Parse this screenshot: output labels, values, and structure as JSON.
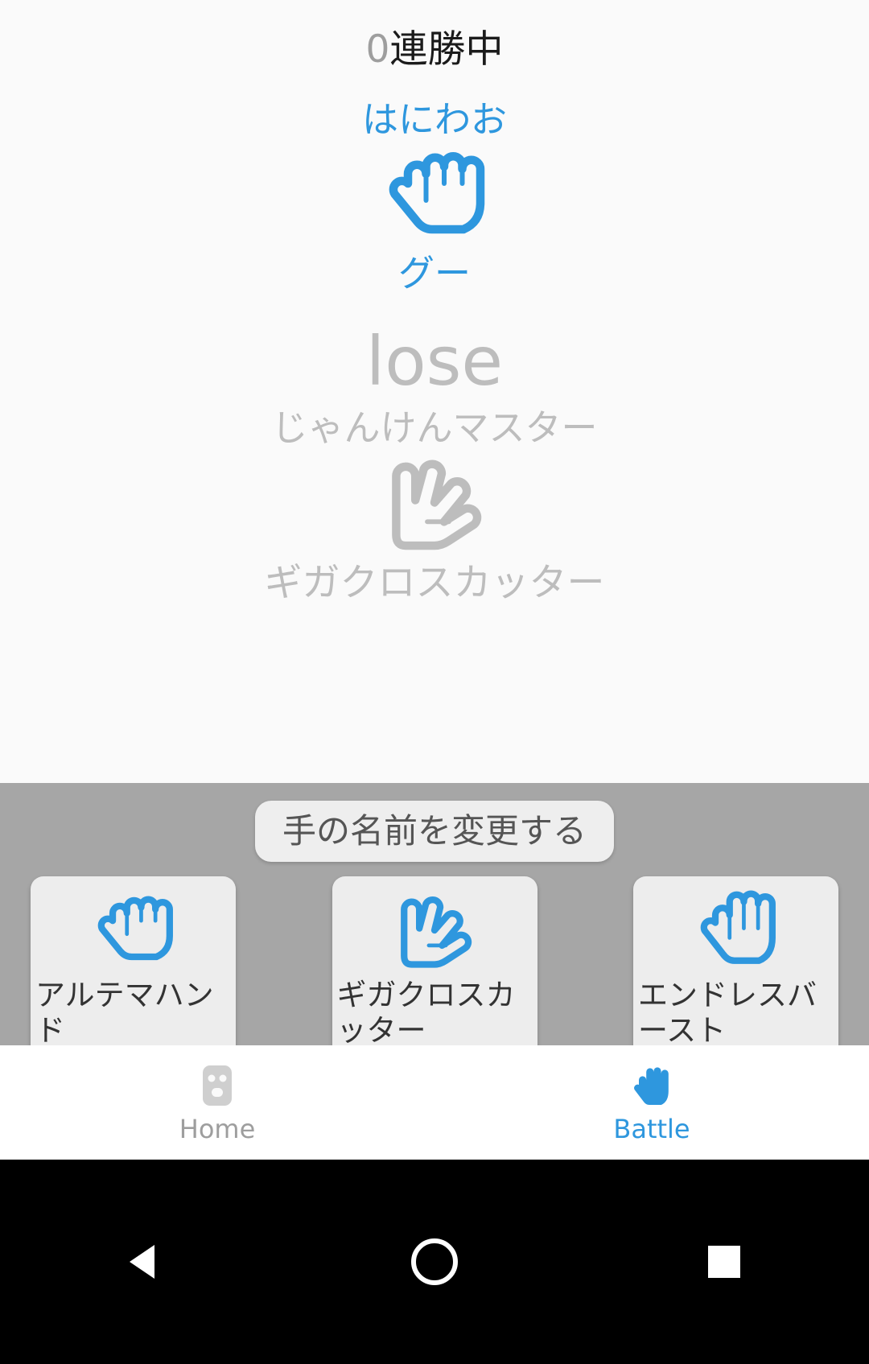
{
  "battle": {
    "streak_count": "0",
    "streak_suffix": "連勝中",
    "player_name": "はにわお",
    "player_hand_icon": "rock-hand-icon",
    "player_hand_label": "グー",
    "result": "lose",
    "opponent_name": "じゃんけんマスター",
    "opponent_hand_icon": "scissors-hand-icon",
    "opponent_hand_label": "ギガクロスカッター",
    "accent_color": "#2e97de",
    "muted_color": "#bdbdbd"
  },
  "choice_panel": {
    "rename_label": "手の名前を変更する",
    "background_color": "#a6a6a6",
    "cards": [
      {
        "icon": "rock-hand-icon",
        "label": "アルテマハンド"
      },
      {
        "icon": "scissors-hand-icon",
        "label": "ギガクロスカッター"
      },
      {
        "icon": "paper-hand-icon",
        "label": "エンドレスバースト"
      }
    ]
  },
  "bottom_nav": {
    "items": [
      {
        "label": "Home",
        "icon": "home-icon",
        "active": false
      },
      {
        "label": "Battle",
        "icon": "battle-hand-icon",
        "active": true
      }
    ]
  },
  "system_bar": {
    "back_icon": "back-triangle-icon",
    "home_icon": "home-circle-icon",
    "recents_icon": "recents-square-icon"
  }
}
